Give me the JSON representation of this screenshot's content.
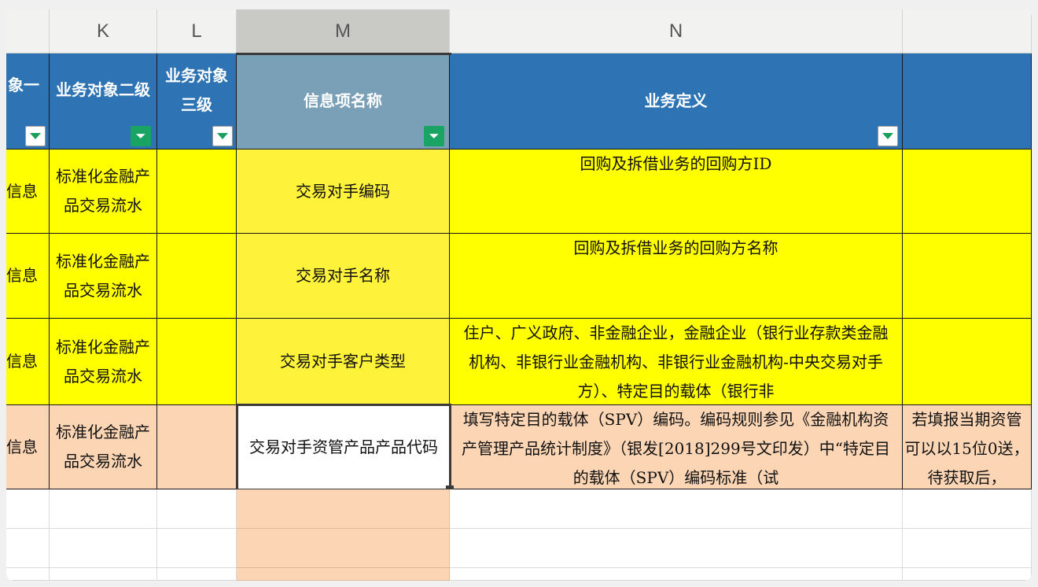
{
  "columns": [
    {
      "id": "J",
      "label": ""
    },
    {
      "id": "K",
      "label": "K"
    },
    {
      "id": "L",
      "label": "L"
    },
    {
      "id": "M",
      "label": "M"
    },
    {
      "id": "N",
      "label": "N"
    },
    {
      "id": "O",
      "label": ""
    }
  ],
  "header_row": {
    "j": "象一",
    "k": "业务对象二级",
    "l": "业务对象三级",
    "m": "信息项名称",
    "n": "业务定义",
    "o": ""
  },
  "rows": [
    {
      "j": "信息",
      "k": "标准化金融产品交易流水",
      "l": "",
      "m": "交易对手编码",
      "n": "回购及拆借业务的回购方ID",
      "o": ""
    },
    {
      "j": "信息",
      "k": "标准化金融产品交易流水",
      "l": "",
      "m": "交易对手名称",
      "n": "回购及拆借业务的回购方名称",
      "o": ""
    },
    {
      "j": "信息",
      "k": "标准化金融产品交易流水",
      "l": "",
      "m": "交易对手客户类型",
      "n": "住户、广义政府、非金融企业，金融企业（银行业存款类金融机构、非银行业金融机构、非银行业金融机构-中央交易对手方）、特定目的载体（银行非",
      "o": ""
    },
    {
      "j": "信息",
      "k": "标准化金融产品交易流水",
      "l": "",
      "m": "交易对手资管产品产品代码",
      "n": "填写特定目的载体（SPV）编码。编码规则参见《金融机构资产管理产品统计制度》（银发[2018]299号文印发）中“特定目的载体（SPV）编码标准（试",
      "o": "若填报当期资管可以以15位0送，待获取后，"
    }
  ],
  "colors": {
    "header_blue": "#2e74b5",
    "yellow": "#ffff00",
    "peach": "#fcd5b4",
    "filter_green": "#19a463"
  }
}
